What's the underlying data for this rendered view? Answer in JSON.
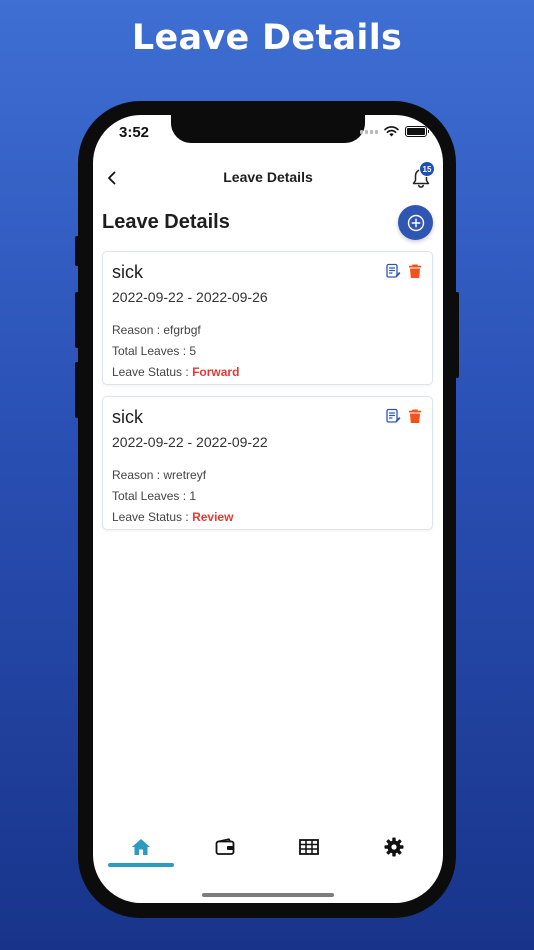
{
  "banner": {
    "title": "Leave Details"
  },
  "status_bar": {
    "time": "3:52"
  },
  "navbar": {
    "title": "Leave Details",
    "notification_count": "15"
  },
  "page": {
    "title": "Leave Details"
  },
  "leaves": [
    {
      "type": "sick",
      "date_range": "2022-09-22 - 2022-09-26",
      "reason_label": "Reason : ",
      "reason": "efgrbgf",
      "total_label": "Total Leaves : ",
      "total": "5",
      "status_label": "Leave Status : ",
      "status": "Forward"
    },
    {
      "type": "sick",
      "date_range": "2022-09-22 - 2022-09-22",
      "reason_label": "Reason : ",
      "reason": "wretreyf",
      "total_label": "Total Leaves : ",
      "total": "1",
      "status_label": "Leave Status : ",
      "status": "Review"
    }
  ],
  "tabs": [
    {
      "icon": "home-icon",
      "active": true
    },
    {
      "icon": "wallet-icon",
      "active": false
    },
    {
      "icon": "table-icon",
      "active": false
    },
    {
      "icon": "gear-icon",
      "active": false
    }
  ],
  "colors": {
    "accent": "#3056b4",
    "status_text": "#e53935",
    "delete": "#f4511e",
    "tab_active": "#2b9bbf"
  }
}
